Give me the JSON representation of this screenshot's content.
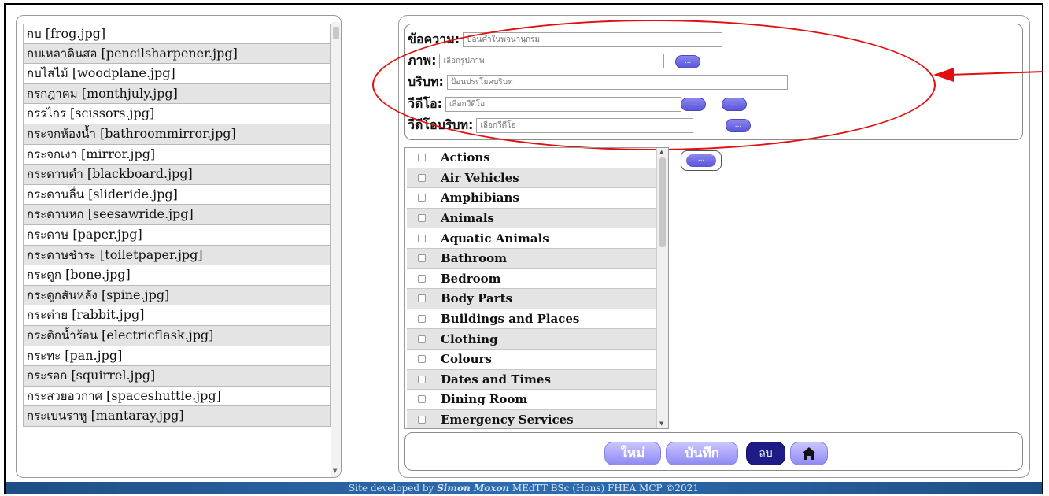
{
  "words": [
    {
      "thai": "กบ",
      "file": "[frog.jpg]"
    },
    {
      "thai": "กบเหลาดินสอ",
      "file": "[pencilsharpener.jpg]"
    },
    {
      "thai": "กบไสไม้",
      "file": "[woodplane.jpg]"
    },
    {
      "thai": "กรกฎาคม",
      "file": "[monthjuly.jpg]"
    },
    {
      "thai": "กรรไกร",
      "file": "[scissors.jpg]"
    },
    {
      "thai": "กระจกห้องน้ำ",
      "file": "[bathroommirror.jpg]"
    },
    {
      "thai": "กระจกเงา",
      "file": "[mirror.jpg]"
    },
    {
      "thai": "กระดานดำ",
      "file": "[blackboard.jpg]"
    },
    {
      "thai": "กระดานลื่น",
      "file": "[slideride.jpg]"
    },
    {
      "thai": "กระดานหก",
      "file": "[seesawride.jpg]"
    },
    {
      "thai": "กระดาษ",
      "file": "[paper.jpg]"
    },
    {
      "thai": "กระดาษชำระ",
      "file": "[toiletpaper.jpg]"
    },
    {
      "thai": "กระดูก",
      "file": "[bone.jpg]"
    },
    {
      "thai": "กระดูกสันหลัง",
      "file": "[spine.jpg]"
    },
    {
      "thai": "กระต่าย",
      "file": "[rabbit.jpg]"
    },
    {
      "thai": "กระติกน้ำร้อน",
      "file": "[electricflask.jpg]"
    },
    {
      "thai": "กระทะ",
      "file": "[pan.jpg]"
    },
    {
      "thai": "กระรอก",
      "file": "[squirrel.jpg]"
    },
    {
      "thai": "กระสวยอวกาศ",
      "file": "[spaceshuttle.jpg]"
    },
    {
      "thai": "กระเบนราหู",
      "file": "[mantaray.jpg]"
    }
  ],
  "form": {
    "message_label": "ข้อความ:",
    "message_placeholder": "ป้อนคำในพจนานุกรม",
    "image_label": "ภาพ:",
    "image_placeholder": "เลือกรูปภาพ",
    "context_label": "บริบท:",
    "context_placeholder": "ป้อนประโยคบริบท",
    "video_label": "วีดีโอ:",
    "video_placeholder": "เลือกวีดีโอ",
    "video_context_label": "วีดีโอบริบท:",
    "video_context_placeholder": "เลือกวีดีโอ",
    "ellipsis": "..."
  },
  "categories": [
    "Actions",
    "Air Vehicles",
    "Amphibians",
    "Animals",
    "Aquatic Animals",
    "Bathroom",
    "Bedroom",
    "Body Parts",
    "Buildings and Places",
    "Clothing",
    "Colours",
    "Dates and Times",
    "Dining Room",
    "Emergency Services"
  ],
  "buttons": {
    "new_label": "ใหม่",
    "save_label": "บันทึก",
    "delete_label": "ลบ",
    "home_icon": "home-icon"
  },
  "footer": {
    "prefix": "Site developed by ",
    "name": "Simon Moxon",
    "suffix": "  MEdTT  BSc (Hons)  FHEA  MCP  ©2021"
  },
  "colors": {
    "accent": "#6f6be8",
    "delete": "#1e1a86",
    "annotation": "#e01010",
    "footer": "#2f6db0"
  }
}
